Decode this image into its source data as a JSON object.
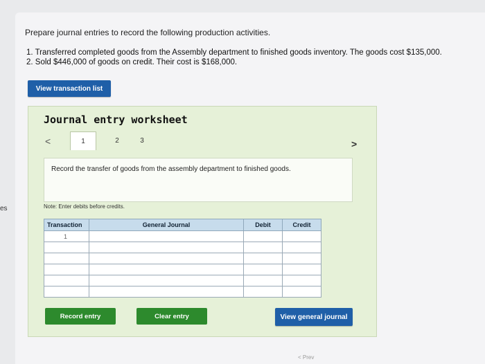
{
  "edge_label": "es",
  "prompt": "Prepare journal entries to record the following production activities.",
  "items": [
    "1. Transferred completed goods from the Assembly department to finished goods inventory. The goods cost $135,000.",
    "2. Sold $446,000 of goods on credit. Their cost is $168,000."
  ],
  "buttons": {
    "view_transaction_list": "View transaction list",
    "record_entry": "Record entry",
    "clear_entry": "Clear entry",
    "view_general_journal": "View general journal"
  },
  "worksheet": {
    "title": "Journal entry worksheet",
    "tabs": [
      "1",
      "2",
      "3"
    ],
    "active_tab": "1",
    "description": "Record the transfer of goods from the assembly department to finished goods.",
    "note": "Note: Enter debits before credits."
  },
  "journal": {
    "headers": [
      "Transaction",
      "General Journal",
      "Debit",
      "Credit"
    ],
    "rows": [
      [
        "1",
        "",
        "",
        ""
      ],
      [
        "",
        "",
        "",
        ""
      ],
      [
        "",
        "",
        "",
        ""
      ],
      [
        "",
        "",
        "",
        ""
      ],
      [
        "",
        "",
        "",
        ""
      ],
      [
        "",
        "",
        "",
        ""
      ]
    ]
  },
  "footer_partial": "< Prev"
}
